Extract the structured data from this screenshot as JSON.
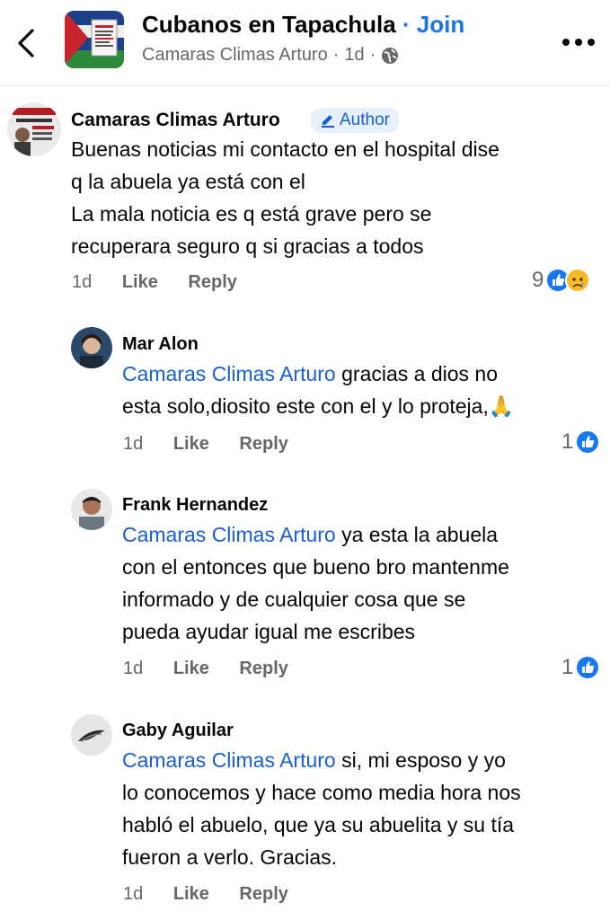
{
  "header": {
    "group_name": "Cubanos en Tapachula",
    "separator": " · ",
    "join_label": "Join",
    "author": "Camaras Climas Arturo",
    "time": "1d",
    "sub_sep": "·"
  },
  "post_comment": {
    "author": "Camaras Climas Arturo",
    "badge": "Author",
    "lines": [
      "Buenas noticias mi contacto en el hospital dise",
      "q la abuela ya está con el",
      "La mala noticia es q está grave pero se",
      "recuperara seguro q si gracias a todos"
    ],
    "time": "1d",
    "like": "Like",
    "reply": "Reply",
    "reactions": "9"
  },
  "replies": [
    {
      "author": "Mar Alon",
      "mention": "Camaras Climas Arturo",
      "line1_rest": " gracias a dios no",
      "lines": [
        "esta solo,diosito este con el y lo proteja,🙏"
      ],
      "time": "1d",
      "like": "Like",
      "reply": "Reply",
      "reactions": "1"
    },
    {
      "author": "Frank Hernandez",
      "mention": "Camaras Climas Arturo",
      "line1_rest": " ya esta la abuela",
      "lines": [
        "con el entonces que bueno bro mantenme",
        "informado y de cualquier cosa que se",
        "pueda ayudar igual me escribes"
      ],
      "time": "1d",
      "like": "Like",
      "reply": "Reply",
      "reactions": "1"
    },
    {
      "author": "Gaby Aguilar",
      "mention": "Camaras Climas Arturo",
      "line1_rest": " si, mi esposo y yo",
      "lines": [
        "lo conocemos y hace como media hora nos",
        "habló el abuelo, que ya su abuelita y su tía",
        "fueron a verlo. Gracias."
      ],
      "time": "1d",
      "like": "Like",
      "reply": "Reply"
    }
  ],
  "colors": {
    "accent": "#1a73e8",
    "mention": "#1a5fd0",
    "muted": "#65676b",
    "like_blue": "#1877f2"
  }
}
